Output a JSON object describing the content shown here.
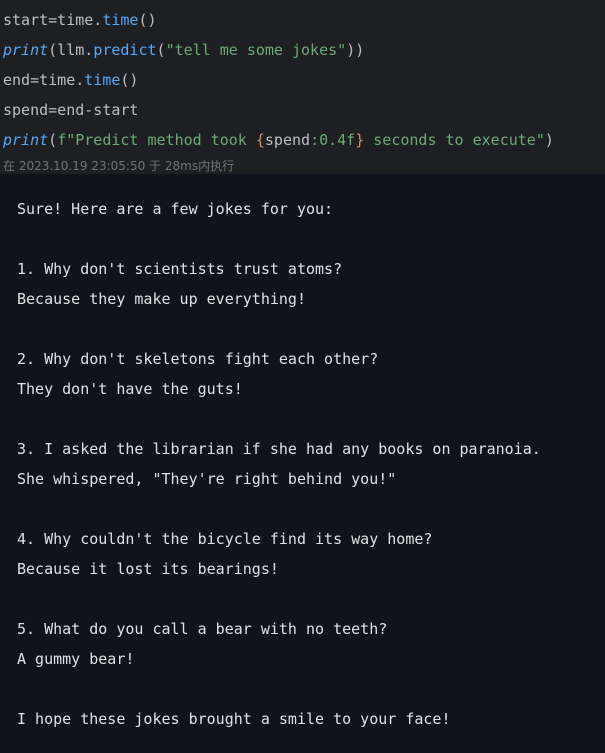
{
  "code": {
    "line1": {
      "a": "start=time.",
      "fn": "time",
      "b": "()"
    },
    "line2": {
      "kw": "print",
      "a": "(llm.",
      "fn": "predict",
      "b": "(",
      "str": "\"tell me some jokes\"",
      "c": "))"
    },
    "line3": {
      "a": "end=time.",
      "fn": "time",
      "b": "()"
    },
    "line4": {
      "a": "spend=end-start"
    },
    "line5": {
      "kw": "print",
      "a": "(",
      "str1": "f\"Predict method took ",
      "brace_open": "{",
      "expr": "spend",
      "fmt": ":0.4f",
      "brace_close": "}",
      "str2": " seconds to execute\"",
      "b": ")"
    }
  },
  "execution_info": "在 2023.10.19 23:05:50 于 28ms内执行",
  "output": {
    "lines": [
      "Sure! Here are a few jokes for you:",
      "",
      "1. Why don't scientists trust atoms?",
      "Because they make up everything!",
      "",
      "2. Why don't skeletons fight each other?",
      "They don't have the guts!",
      "",
      "3. I asked the librarian if she had any books on paranoia.",
      "She whispered, \"They're right behind you!\"",
      "",
      "4. Why couldn't the bicycle find its way home?",
      "Because it lost its bearings!",
      "",
      "5. What do you call a bear with no teeth?",
      "A gummy bear!",
      "",
      "I hope these jokes brought a smile to your face!"
    ]
  },
  "colors": {
    "code_background": "#1e1f22",
    "output_background": "#0f131c",
    "function": "#56a8f5",
    "string": "#6aab73",
    "brace": "#cf8e6d",
    "text": "#bcbec4",
    "meta": "#6f737a"
  }
}
